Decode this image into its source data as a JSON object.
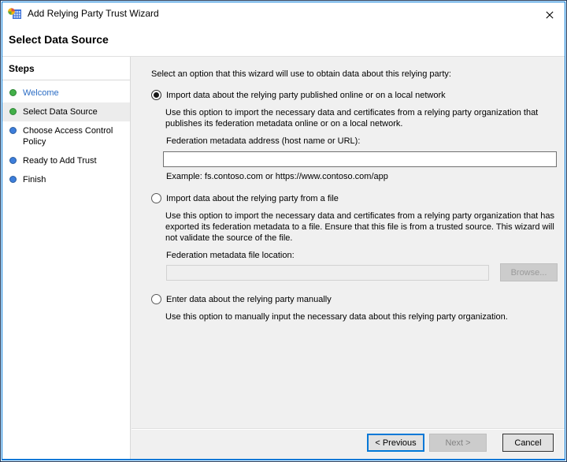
{
  "window": {
    "title": "Add Relying Party Trust Wizard",
    "close_icon": "close"
  },
  "header": {
    "title": "Select Data Source"
  },
  "sidebar": {
    "title": "Steps",
    "items": [
      {
        "label": "Welcome",
        "status": "done",
        "current": false
      },
      {
        "label": "Select Data Source",
        "status": "done",
        "current": true
      },
      {
        "label": "Choose Access Control Policy",
        "status": "todo",
        "current": false
      },
      {
        "label": "Ready to Add Trust",
        "status": "todo",
        "current": false
      },
      {
        "label": "Finish",
        "status": "todo",
        "current": false
      }
    ]
  },
  "main": {
    "intro": "Select an option that this wizard will use to obtain data about this relying party:",
    "option_online": {
      "selected": true,
      "label": "Import data about the relying party published online or on a local network",
      "description": "Use this option to import the necessary data and certificates from a relying party organization that publishes its federation metadata online or on a local network.",
      "address_label": "Federation metadata address (host name or URL):",
      "address_value": "",
      "example": "Example: fs.contoso.com or https://www.contoso.com/app"
    },
    "option_file": {
      "selected": false,
      "label": "Import data about the relying party from a file",
      "description": "Use this option to import the necessary data and certificates from a relying party organization that has exported its federation metadata to a file. Ensure that this file is from a trusted source.  This wizard will not validate the source of the file.",
      "file_label": "Federation metadata file location:",
      "file_value": "",
      "browse_label": "Browse..."
    },
    "option_manual": {
      "selected": false,
      "label": "Enter data about the relying party manually",
      "description": "Use this option to manually input the necessary data about this relying party organization."
    }
  },
  "footer": {
    "previous_label": "< Previous",
    "next_label": "Next >",
    "next_enabled": false,
    "cancel_label": "Cancel"
  },
  "colors": {
    "accent_border": "#0078d7",
    "content_background": "#f0f0f0",
    "step_done_bullet": "#43b049",
    "step_todo_bullet": "#3d7edb",
    "link_blue": "#2a6cc4",
    "disabled_text": "#838383"
  }
}
